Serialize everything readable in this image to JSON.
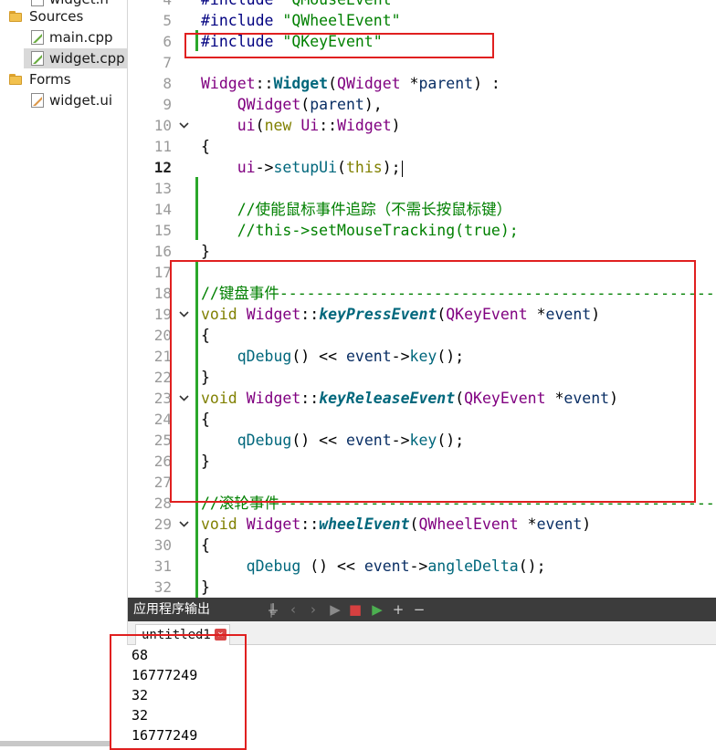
{
  "tree": {
    "items": [
      {
        "label": "widget.h",
        "type": "file-h"
      },
      {
        "label": "Sources",
        "type": "folder"
      },
      {
        "label": "main.cpp",
        "type": "file-cpp"
      },
      {
        "label": "widget.cpp",
        "type": "file-cpp",
        "selected": true
      },
      {
        "label": "Forms",
        "type": "folder"
      },
      {
        "label": "widget.ui",
        "type": "file-ui"
      }
    ]
  },
  "editor": {
    "current_line": "12",
    "lines": [
      {
        "num": "4",
        "parts": [
          [
            "pp",
            "#include "
          ],
          [
            "str",
            "\"QMouseEvent\""
          ]
        ]
      },
      {
        "num": "5",
        "parts": [
          [
            "pp",
            "#include "
          ],
          [
            "str",
            "\"QWheelEvent\""
          ]
        ]
      },
      {
        "num": "6",
        "parts": [
          [
            "pp",
            "#include "
          ],
          [
            "str",
            "\"QKeyEvent\""
          ]
        ]
      },
      {
        "num": "7",
        "parts": []
      },
      {
        "num": "8",
        "parts": [
          [
            "cls",
            "Widget"
          ],
          [
            "plain",
            "::"
          ],
          [
            "fn-def",
            "Widget"
          ],
          [
            "plain",
            "("
          ],
          [
            "cls",
            "QWidget"
          ],
          [
            "plain",
            " *"
          ],
          [
            "param",
            "parent"
          ],
          [
            "plain",
            ") :"
          ]
        ]
      },
      {
        "num": "9",
        "parts": [
          [
            "plain",
            "    "
          ],
          [
            "cls",
            "QWidget"
          ],
          [
            "plain",
            "("
          ],
          [
            "param",
            "parent"
          ],
          [
            "plain",
            "),"
          ]
        ]
      },
      {
        "num": "10",
        "parts": [
          [
            "plain",
            "    "
          ],
          [
            "cls",
            "ui"
          ],
          [
            "plain",
            "("
          ],
          [
            "kw",
            "new"
          ],
          [
            "plain",
            " "
          ],
          [
            "cls",
            "Ui"
          ],
          [
            "plain",
            "::"
          ],
          [
            "cls",
            "Widget"
          ],
          [
            "plain",
            ")"
          ]
        ],
        "fold": true
      },
      {
        "num": "11",
        "parts": [
          [
            "plain",
            "{"
          ]
        ]
      },
      {
        "num": "12",
        "parts": [
          [
            "plain",
            "    "
          ],
          [
            "cls",
            "ui"
          ],
          [
            "plain",
            "->"
          ],
          [
            "method",
            "setupUi"
          ],
          [
            "plain",
            "("
          ],
          [
            "kw",
            "this"
          ],
          [
            "plain",
            ");"
          ]
        ],
        "caret": true
      },
      {
        "num": "13",
        "parts": []
      },
      {
        "num": "14",
        "parts": [
          [
            "plain",
            "    "
          ],
          [
            "cmt",
            "//使能鼠标事件追踪（不需长按鼠标键）"
          ]
        ]
      },
      {
        "num": "15",
        "parts": [
          [
            "plain",
            "    "
          ],
          [
            "cmt",
            "//this->setMouseTracking(true);"
          ]
        ]
      },
      {
        "num": "16",
        "parts": [
          [
            "plain",
            "}"
          ]
        ]
      },
      {
        "num": "17",
        "parts": []
      },
      {
        "num": "18",
        "parts": [
          [
            "cmt",
            "//键盘事件------------------------------------------------"
          ]
        ]
      },
      {
        "num": "19",
        "parts": [
          [
            "kw",
            "void"
          ],
          [
            "plain",
            " "
          ],
          [
            "cls",
            "Widget"
          ],
          [
            "plain",
            "::"
          ],
          [
            "fn-italic",
            "keyPressEvent"
          ],
          [
            "plain",
            "("
          ],
          [
            "cls",
            "QKeyEvent"
          ],
          [
            "plain",
            " *"
          ],
          [
            "param",
            "event"
          ],
          [
            "plain",
            ")"
          ]
        ],
        "fold": true
      },
      {
        "num": "20",
        "parts": [
          [
            "plain",
            "{"
          ]
        ]
      },
      {
        "num": "21",
        "parts": [
          [
            "plain",
            "    "
          ],
          [
            "method",
            "qDebug"
          ],
          [
            "plain",
            "() << "
          ],
          [
            "param",
            "event"
          ],
          [
            "plain",
            "->"
          ],
          [
            "method",
            "key"
          ],
          [
            "plain",
            "();"
          ]
        ]
      },
      {
        "num": "22",
        "parts": [
          [
            "plain",
            "}"
          ]
        ]
      },
      {
        "num": "23",
        "parts": [
          [
            "kw",
            "void"
          ],
          [
            "plain",
            " "
          ],
          [
            "cls",
            "Widget"
          ],
          [
            "plain",
            "::"
          ],
          [
            "fn-italic",
            "keyReleaseEvent"
          ],
          [
            "plain",
            "("
          ],
          [
            "cls",
            "QKeyEvent"
          ],
          [
            "plain",
            " *"
          ],
          [
            "param",
            "event"
          ],
          [
            "plain",
            ")"
          ]
        ],
        "fold": true
      },
      {
        "num": "24",
        "parts": [
          [
            "plain",
            "{"
          ]
        ]
      },
      {
        "num": "25",
        "parts": [
          [
            "plain",
            "    "
          ],
          [
            "method",
            "qDebug"
          ],
          [
            "plain",
            "() << "
          ],
          [
            "param",
            "event"
          ],
          [
            "plain",
            "->"
          ],
          [
            "method",
            "key"
          ],
          [
            "plain",
            "();"
          ]
        ]
      },
      {
        "num": "26",
        "parts": [
          [
            "plain",
            "}"
          ]
        ]
      },
      {
        "num": "27",
        "parts": []
      },
      {
        "num": "28",
        "parts": [
          [
            "cmt",
            "//滚轮事件------------------------------------------------"
          ]
        ]
      },
      {
        "num": "29",
        "parts": [
          [
            "kw",
            "void"
          ],
          [
            "plain",
            " "
          ],
          [
            "cls",
            "Widget"
          ],
          [
            "plain",
            "::"
          ],
          [
            "fn-italic",
            "wheelEvent"
          ],
          [
            "plain",
            "("
          ],
          [
            "cls",
            "QWheelEvent"
          ],
          [
            "plain",
            " *"
          ],
          [
            "param",
            "event"
          ],
          [
            "plain",
            ")"
          ]
        ],
        "fold": true
      },
      {
        "num": "30",
        "parts": [
          [
            "plain",
            "{"
          ]
        ]
      },
      {
        "num": "31",
        "parts": [
          [
            "plain",
            "     "
          ],
          [
            "method",
            "qDebug"
          ],
          [
            "plain",
            " () << "
          ],
          [
            "param",
            "event"
          ],
          [
            "plain",
            "->"
          ],
          [
            "method",
            "angleDelta"
          ],
          [
            "plain",
            "();"
          ]
        ]
      },
      {
        "num": "32",
        "parts": [
          [
            "plain",
            "}"
          ]
        ]
      }
    ]
  },
  "output": {
    "title": "应用程序输出",
    "tab_label": "untitled1",
    "lines": [
      "68",
      "16777249",
      "32",
      "32",
      "16777249"
    ]
  },
  "colors": {
    "annotation": "#e02020",
    "diff_bar": "#2ba72b"
  }
}
